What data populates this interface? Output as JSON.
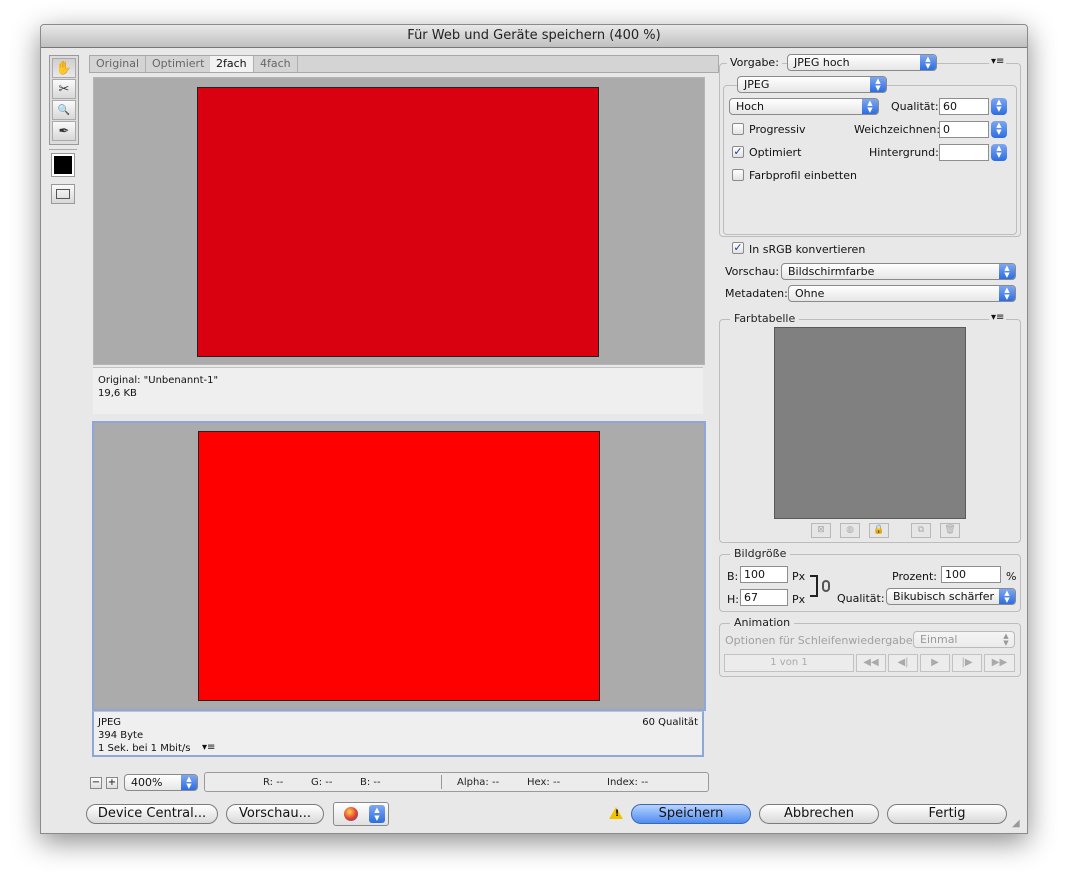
{
  "window": {
    "title": "Für Web und Geräte speichern (400 %)"
  },
  "tools": {
    "hand": "✋",
    "slice_select": "✂",
    "zoom": "🔍",
    "eyedropper": "✒",
    "swatch_color": "#000000"
  },
  "tabs": [
    {
      "label": "Original"
    },
    {
      "label": "Optimiert"
    },
    {
      "label": "2fach"
    },
    {
      "label": "4fach"
    }
  ],
  "preview_top": {
    "image_color": "#d90010",
    "info_line1": "Original: \"Unbenannt-1\"",
    "info_line2": "19,6 KB"
  },
  "preview_bottom": {
    "image_color": "#ff0000",
    "format": "JPEG",
    "size": "394 Byte",
    "time": "1 Sek. bei 1 Mbit/s",
    "quality": "60 Qualität"
  },
  "settings": {
    "vorgabe_label": "Vorgabe:",
    "vorgabe_value": "JPEG hoch",
    "format_value": "JPEG",
    "compression_value": "Hoch",
    "qualitaet_label": "Qualität:",
    "qualitaet_value": "60",
    "progressiv_label": "Progressiv",
    "progressiv_checked": false,
    "weichzeichnen_label": "Weichzeichnen:",
    "weichzeichnen_value": "0",
    "optimiert_label": "Optimiert",
    "optimiert_checked": true,
    "hintergrund_label": "Hintergrund:",
    "hintergrund_value": "",
    "farbprofil_label": "Farbprofil einbetten",
    "farbprofil_checked": false,
    "srgb_label": "In sRGB konvertieren",
    "srgb_checked": true,
    "vorschau_label": "Vorschau:",
    "vorschau_value": "Bildschirmfarbe",
    "metadaten_label": "Metadaten:",
    "metadaten_value": "Ohne"
  },
  "farbtabelle": {
    "title": "Farbtabelle",
    "swatch_color": "#808080"
  },
  "bildgroesse": {
    "title": "Bildgröße",
    "b_label": "B:",
    "b_value": "100",
    "h_label": "H:",
    "h_value": "67",
    "unit": "Px",
    "prozent_label": "Prozent:",
    "prozent_value": "100",
    "percent_sign": "%",
    "qualitaet_label": "Qualität:",
    "qualitaet_value": "Bikubisch schärfer"
  },
  "animation": {
    "title": "Animation",
    "loop_label": "Optionen für Schleifenwiedergabe:",
    "loop_value": "Einmal",
    "frame_counter": "1 von 1"
  },
  "status": {
    "zoom": "400%",
    "r": "R: --",
    "g": "G: --",
    "b": "B: --",
    "alpha": "Alpha: --",
    "hex": "Hex: --",
    "index": "Index: --"
  },
  "buttons": {
    "device_central": "Device Central...",
    "vorschau": "Vorschau...",
    "speichern": "Speichern",
    "abbrechen": "Abbrechen",
    "fertig": "Fertig"
  },
  "colors": {
    "accent": "#4e8cf0",
    "selection_border": "#8ca7d8"
  }
}
